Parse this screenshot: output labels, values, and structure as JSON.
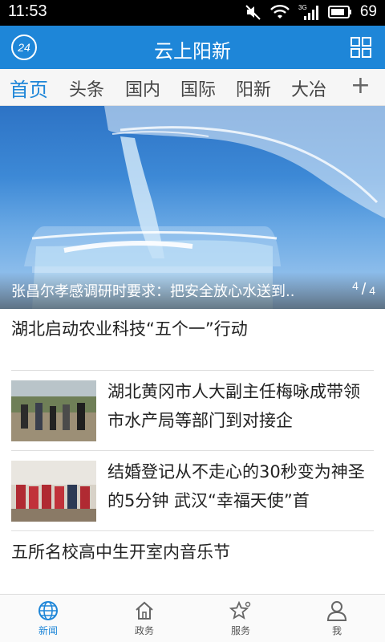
{
  "status_bar": {
    "time": "11:53",
    "network": "3G",
    "battery_percent": "69"
  },
  "header": {
    "badge_label": "24",
    "title": "云上阳新"
  },
  "tabs": [
    {
      "label": "首页",
      "active": true
    },
    {
      "label": "头条"
    },
    {
      "label": "国内"
    },
    {
      "label": "国际"
    },
    {
      "label": "阳新"
    },
    {
      "label": "大冶"
    }
  ],
  "tab_add_label": "+",
  "banner": {
    "caption": "张昌尔孝感调研时要求：把安全放心水送到..",
    "pager_current": "4",
    "pager_total": "4"
  },
  "news": {
    "headline_1": "湖北启动农业科技“五个一”行动",
    "item_1_title": "湖北黄冈市人大副主任梅咏成带领市水产局等部门到对接企",
    "item_2_title": "结婚登记从不走心的30秒变为神圣的5分钟 武汉“幸福天使”首",
    "headline_2": "五所名校高中生开室内音乐节"
  },
  "bottom_nav": [
    {
      "label": "新闻",
      "icon": "globe-icon",
      "active": true
    },
    {
      "label": "政务",
      "icon": "home-icon"
    },
    {
      "label": "服务",
      "icon": "star-icon"
    },
    {
      "label": "我",
      "icon": "person-icon"
    }
  ],
  "colors": {
    "accent": "#1e86d8",
    "status_bar": "#000000"
  }
}
